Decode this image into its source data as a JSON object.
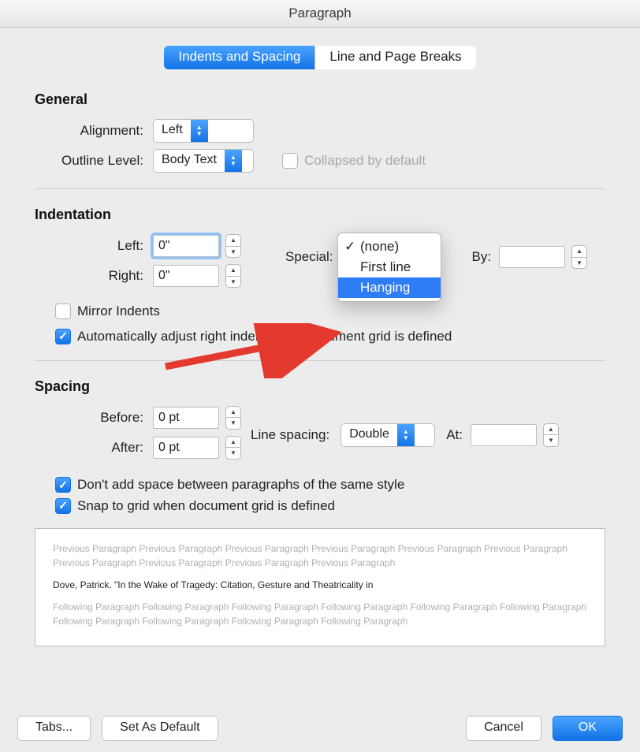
{
  "window": {
    "title": "Paragraph"
  },
  "tabs": {
    "indents_spacing": "Indents and Spacing",
    "line_page_breaks": "Line and Page Breaks"
  },
  "general": {
    "heading": "General",
    "alignment_label": "Alignment:",
    "alignment_value": "Left",
    "outline_label": "Outline Level:",
    "outline_value": "Body Text",
    "collapsed_label": "Collapsed by default"
  },
  "indentation": {
    "heading": "Indentation",
    "left_label": "Left:",
    "left_value": "0\"",
    "right_label": "Right:",
    "right_value": "0\"",
    "special_label": "Special:",
    "special_options": {
      "none": "(none)",
      "first_line": "First line",
      "hanging": "Hanging"
    },
    "by_label": "By:",
    "by_value": "",
    "mirror_label": "Mirror Indents",
    "auto_label": "Automatically adjust right indent when document grid is defined"
  },
  "spacing": {
    "heading": "Spacing",
    "before_label": "Before:",
    "before_value": "0 pt",
    "after_label": "After:",
    "after_value": "0 pt",
    "line_spacing_label": "Line spacing:",
    "line_spacing_value": "Double",
    "at_label": "At:",
    "at_value": "",
    "dont_add_label": "Don't add space between paragraphs of the same style",
    "snap_label": "Snap to grid when document grid is defined"
  },
  "preview": {
    "prev_text": "Previous Paragraph Previous Paragraph Previous Paragraph Previous Paragraph Previous Paragraph Previous Paragraph Previous Paragraph Previous Paragraph Previous Paragraph Previous Paragraph",
    "sample_text": "Dove, Patrick. \"In the Wake of Tragedy: Citation, Gesture and Theatricality in",
    "next_text": "Following Paragraph Following Paragraph Following Paragraph Following Paragraph Following Paragraph Following Paragraph Following Paragraph Following Paragraph Following Paragraph Following Paragraph"
  },
  "buttons": {
    "tabs": "Tabs...",
    "set_default": "Set As Default",
    "cancel": "Cancel",
    "ok": "OK"
  }
}
